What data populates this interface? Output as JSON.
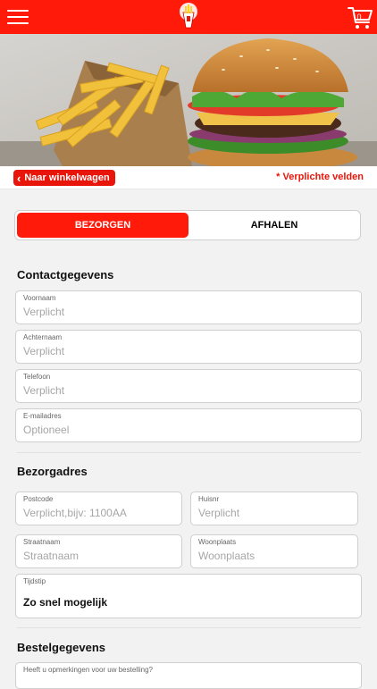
{
  "header": {
    "menu_icon": "hamburger-icon",
    "logo_icon": "fries-logo-icon",
    "cart_icon": "shopping-cart-icon",
    "cart_count": "0",
    "brand_color": "#ff1a0a"
  },
  "hero": {
    "image": "burger-and-fries-photo"
  },
  "nav": {
    "back_label": "Naar winkelwagen",
    "back_icon": "chevron-left-icon",
    "required_note": "* Verplichte velden"
  },
  "delivery_toggle": {
    "options": [
      "BEZORGEN",
      "AFHALEN"
    ],
    "selected": "BEZORGEN"
  },
  "contact": {
    "title": "Contactgegevens",
    "fields": [
      {
        "label": "Voornaam",
        "placeholder": "Verplicht"
      },
      {
        "label": "Achternaam",
        "placeholder": "Verplicht"
      },
      {
        "label": "Telefoon",
        "placeholder": "Verplicht"
      },
      {
        "label": "E-mailadres",
        "placeholder": "Optioneel"
      }
    ]
  },
  "address": {
    "title": "Bezorgadres",
    "postcode": {
      "label": "Postcode",
      "placeholder": "Verplicht,bijv: 1100AA"
    },
    "huisnr": {
      "label": "Huisnr",
      "placeholder": "Verplicht"
    },
    "straat": {
      "label": "Straatnaam",
      "placeholder": "Straatnaam"
    },
    "woonplaats": {
      "label": "Woonplaats",
      "placeholder": "Woonplaats"
    },
    "tijdstip": {
      "label": "Tijdstip",
      "value": "Zo snel mogelijk"
    }
  },
  "order": {
    "title": "Bestelgegevens",
    "remarks_label": "Heeft u opmerkingen voor uw bestelling?"
  }
}
